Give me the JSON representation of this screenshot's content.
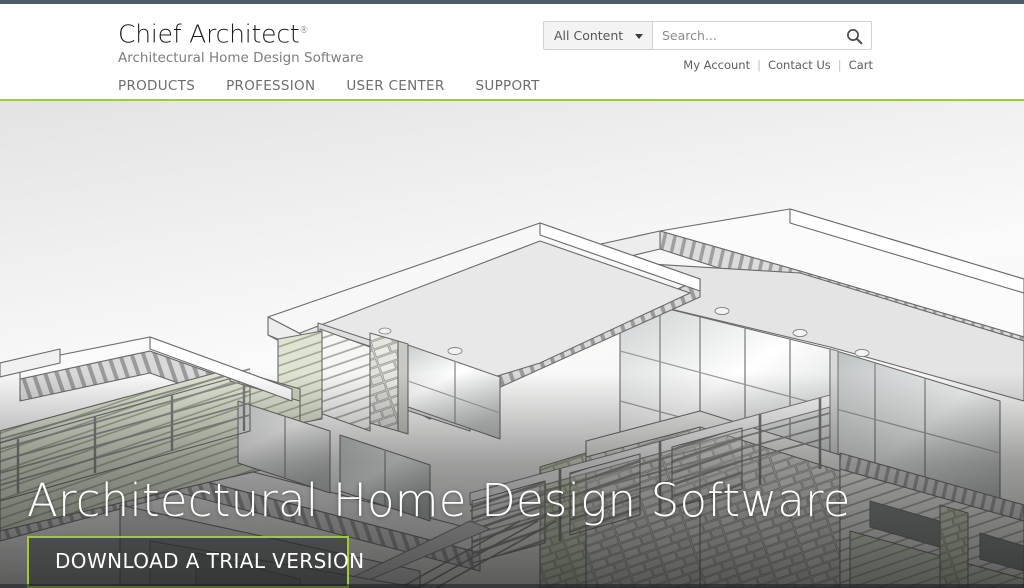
{
  "topbar": {
    "color": "#4d5c6b"
  },
  "header": {
    "logo": {
      "name": "Chief Architect",
      "registered_mark": "®",
      "tagline": "Architectural Home Design Software"
    },
    "search": {
      "scope_selected": "All Content",
      "scope_options": [
        "All Content"
      ],
      "placeholder": "Search...",
      "value": "",
      "icon": "search-icon"
    },
    "utility_links": [
      {
        "label": "My Account"
      },
      {
        "label": "Contact Us"
      },
      {
        "label": "Cart"
      }
    ],
    "utility_separator": "|",
    "nav": [
      {
        "label": "PRODUCTS"
      },
      {
        "label": "PROFESSION"
      },
      {
        "label": "USER CENTER"
      },
      {
        "label": "SUPPORT"
      }
    ],
    "accent_rule_color": "#9fcb3b"
  },
  "hero": {
    "title": "Architectural Home Design Software",
    "cta_label": "DOWNLOAD A TRIAL VERSION",
    "cta_border_color": "#9fcb3b",
    "image_description": "Line-art architectural rendering of a modern flat-roof home with deep eaves, exposed joists, stone columns, glass curtain walls, horizontal siding and deck railings"
  },
  "colors": {
    "accent_green": "#9fcb3b",
    "top_strip": "#4d5c6b",
    "nav_text": "#6d6d6d",
    "logo_text": "#1c1c1c",
    "tagline_text": "#7d7d7d"
  }
}
